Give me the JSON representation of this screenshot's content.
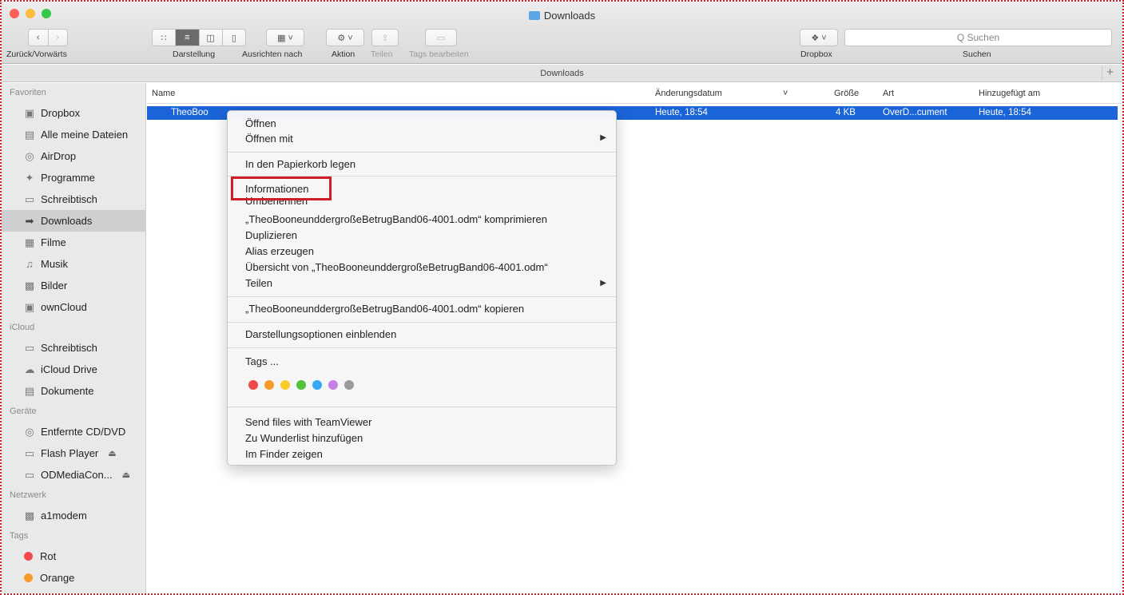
{
  "window": {
    "title": "Downloads"
  },
  "toolbar": {
    "nav_label": "Zurück/Vorwärts",
    "view_label": "Darstellung",
    "arrange_label": "Ausrichten nach",
    "action_label": "Aktion",
    "share_label": "Teilen",
    "tags_label": "Tags bearbeiten",
    "dropbox_label": "Dropbox",
    "search_label": "Suchen",
    "search_placeholder": "Q Suchen"
  },
  "pathbar": {
    "title": "Downloads"
  },
  "sidebar": {
    "favorites_header": "Favoriten",
    "favorites": [
      {
        "label": "Dropbox",
        "icon": "folder-icon"
      },
      {
        "label": "Alle meine Dateien",
        "icon": "files-icon"
      },
      {
        "label": "AirDrop",
        "icon": "airdrop-icon"
      },
      {
        "label": "Programme",
        "icon": "apps-icon"
      },
      {
        "label": "Schreibtisch",
        "icon": "desktop-icon"
      },
      {
        "label": "Downloads",
        "icon": "download-icon"
      },
      {
        "label": "Filme",
        "icon": "film-icon"
      },
      {
        "label": "Musik",
        "icon": "music-icon"
      },
      {
        "label": "Bilder",
        "icon": "camera-icon"
      },
      {
        "label": "ownCloud",
        "icon": "folder-icon"
      }
    ],
    "icloud_header": "iCloud",
    "icloud": [
      {
        "label": "Schreibtisch"
      },
      {
        "label": "iCloud Drive"
      },
      {
        "label": "Dokumente"
      }
    ],
    "devices_header": "Geräte",
    "devices": [
      {
        "label": "Entfernte CD/DVD"
      },
      {
        "label": "Flash Player"
      },
      {
        "label": "ODMediaCon..."
      }
    ],
    "network_header": "Netzwerk",
    "network": [
      {
        "label": "a1modem"
      }
    ],
    "tags_header": "Tags",
    "tags": [
      {
        "label": "Rot",
        "color": "#f0494a"
      },
      {
        "label": "Orange",
        "color": "#f59b2a"
      }
    ]
  },
  "list": {
    "col_name": "Name",
    "col_modified": "Änderungsdatum",
    "col_size": "Größe",
    "col_kind": "Art",
    "col_added": "Hinzugefügt am",
    "file": {
      "name": "TheoBoo",
      "modified": "Heute, 18:54",
      "size": "4 KB",
      "kind": "OverD...cument",
      "added": "Heute, 18:54"
    }
  },
  "context_menu": {
    "open": "Öffnen",
    "open_with": "Öffnen mit",
    "trash": "In den Papierkorb legen",
    "info": "Informationen",
    "rename": "Umbenennen",
    "compress": "„TheoBooneunddergroßeBetrugBand06-4001.odm“ komprimieren",
    "duplicate": "Duplizieren",
    "alias": "Alias erzeugen",
    "quicklook": "Übersicht von „TheoBooneunddergroßeBetrugBand06-4001.odm“",
    "share": "Teilen",
    "copy": "„TheoBooneunddergroßeBetrugBand06-4001.odm“ kopieren",
    "view_options": "Darstellungsoptionen einblenden",
    "tags": "Tags ...",
    "tag_colors": [
      "#f0494a",
      "#f59b2a",
      "#f5cc2a",
      "#53c23a",
      "#35a8f3",
      "#c57ee5",
      "#9b9b9b"
    ],
    "teamviewer": "Send files with TeamViewer",
    "wunderlist": "Zu Wunderlist hinzufügen",
    "show_in_finder": "Im Finder zeigen"
  }
}
